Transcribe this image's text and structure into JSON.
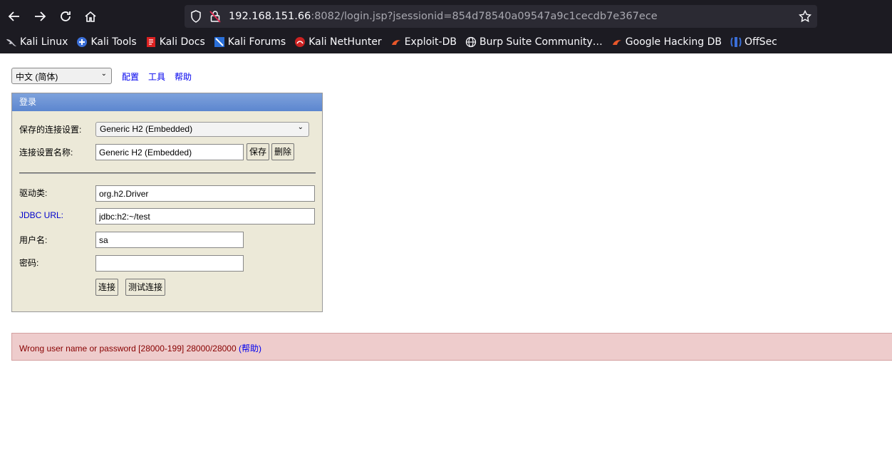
{
  "browser": {
    "url_host": "192.168.151.66",
    "url_rest": ":8082/login.jsp?jsessionid=854d78540a09547a9c1cecdb7e367ece",
    "bookmarks": [
      {
        "label": "Kali Linux",
        "icon": "kali-dragon-icon"
      },
      {
        "label": "Kali Tools",
        "icon": "kali-tools-icon"
      },
      {
        "label": "Kali Docs",
        "icon": "kali-docs-icon"
      },
      {
        "label": "Kali Forums",
        "icon": "kali-forums-icon"
      },
      {
        "label": "Kali NetHunter",
        "icon": "kali-nethunter-icon"
      },
      {
        "label": "Exploit-DB",
        "icon": "exploit-db-icon"
      },
      {
        "label": "Burp Suite Community…",
        "icon": "globe-icon"
      },
      {
        "label": "Google Hacking DB",
        "icon": "exploit-db-icon"
      },
      {
        "label": "OffSec",
        "icon": "offsec-icon"
      }
    ]
  },
  "topbar": {
    "language_selected": "中文 (简体)",
    "links": [
      "配置",
      "工具",
      "帮助"
    ]
  },
  "login": {
    "header": "登录",
    "saved_settings_label": "保存的连接设置:",
    "saved_settings_value": "Generic H2 (Embedded)",
    "setting_name_label": "连接设置名称:",
    "setting_name_value": "Generic H2 (Embedded)",
    "save_button": "保存",
    "delete_button": "删除",
    "driver_label": "驱动类:",
    "driver_value": "org.h2.Driver",
    "jdbc_label": "JDBC URL:",
    "jdbc_value": "jdbc:h2:~/test",
    "user_label": "用户名:",
    "user_value": "sa",
    "password_label": "密码:",
    "password_value": "",
    "connect_button": "连接",
    "test_button": "测试连接"
  },
  "error": {
    "message": "Wrong user name or password [28000-199] 28000/28000",
    "help_link": "(帮助)"
  },
  "colors": {
    "chrome_bg": "#1c1b22",
    "login_bg": "#ece9d8",
    "header_blue": "#5c86cf",
    "error_bg": "#eecccc",
    "error_text": "#880000"
  }
}
